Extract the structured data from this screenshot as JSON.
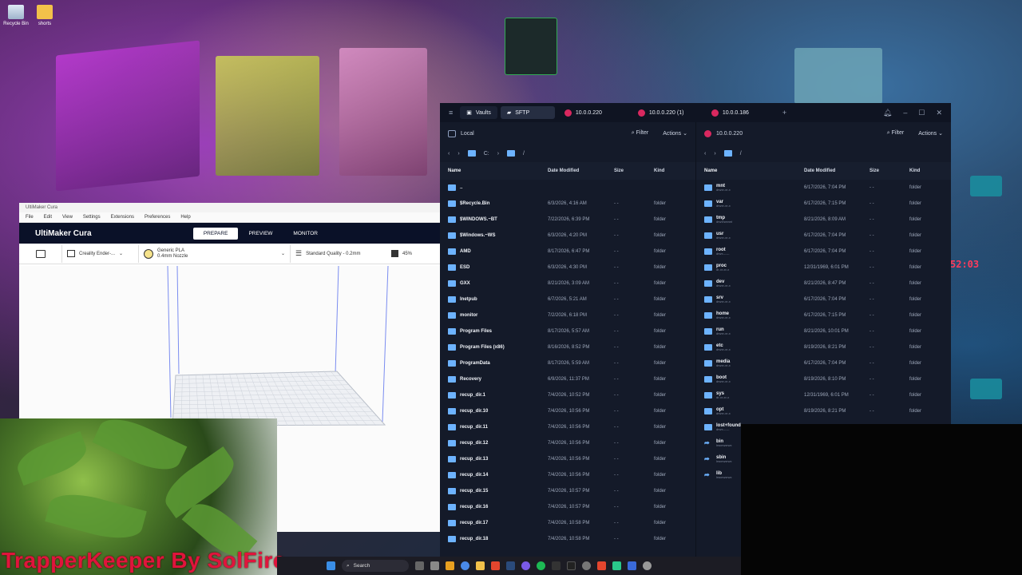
{
  "desktop": {
    "icons": [
      {
        "label": "Recycle Bin"
      },
      {
        "label": "shorts"
      }
    ],
    "clock": "52:03"
  },
  "cura": {
    "window_title": "UltiMaker Cura",
    "menu": [
      "File",
      "Edit",
      "View",
      "Settings",
      "Extensions",
      "Preferences",
      "Help"
    ],
    "logo": "UltiMaker Cura",
    "tabs": [
      "PREPARE",
      "PREVIEW",
      "MONITOR"
    ],
    "printer": "Creality Ender-...",
    "material": "Generic PLA",
    "nozzle": "0.4mm Nozzle",
    "quality": "Standard Quality - 0.2mm",
    "infill": "45%"
  },
  "termius": {
    "tabs": {
      "vaults": "Vaults",
      "sftp": "SFTP",
      "hosts": [
        "10.0.0.220",
        "10.0.0.220 (1)",
        "10.0.0.186"
      ]
    },
    "left": {
      "title": "Local",
      "filter": "Filter",
      "actions": "Actions",
      "path_drive": "C:",
      "path_sep": "/",
      "columns": [
        "Name",
        "Date Modified",
        "Size",
        "Kind"
      ],
      "rows": [
        {
          "name": "..",
          "date": "",
          "size": "",
          "kind": ""
        },
        {
          "name": "$Recycle.Bin",
          "date": "6/3/2026, 4:16 AM",
          "size": "- -",
          "kind": "folder"
        },
        {
          "name": "$WINDOWS.~BT",
          "date": "7/22/2026, 6:39 PM",
          "size": "- -",
          "kind": "folder"
        },
        {
          "name": "$Windows.~WS",
          "date": "6/3/2026, 4:20 PM",
          "size": "- -",
          "kind": "folder"
        },
        {
          "name": "AMD",
          "date": "8/17/2026, 6:47 PM",
          "size": "- -",
          "kind": "folder"
        },
        {
          "name": "ESD",
          "date": "6/3/2026, 4:30 PM",
          "size": "- -",
          "kind": "folder"
        },
        {
          "name": "GXX",
          "date": "8/21/2026, 3:09 AM",
          "size": "- -",
          "kind": "folder"
        },
        {
          "name": "Inetpub",
          "date": "6/7/2026, 5:21 AM",
          "size": "- -",
          "kind": "folder"
        },
        {
          "name": "monitor",
          "date": "7/2/2026, 6:18 PM",
          "size": "- -",
          "kind": "folder"
        },
        {
          "name": "Program Files",
          "date": "8/17/2026, 5:57 AM",
          "size": "- -",
          "kind": "folder"
        },
        {
          "name": "Program Files (x86)",
          "date": "8/16/2026, 8:52 PM",
          "size": "- -",
          "kind": "folder"
        },
        {
          "name": "ProgramData",
          "date": "8/17/2026, 5:59 AM",
          "size": "- -",
          "kind": "folder"
        },
        {
          "name": "Recovery",
          "date": "6/9/2026, 11:37 PM",
          "size": "- -",
          "kind": "folder"
        },
        {
          "name": "recup_dir.1",
          "date": "7/4/2026, 10:52 PM",
          "size": "- -",
          "kind": "folder"
        },
        {
          "name": "recup_dir.10",
          "date": "7/4/2026, 10:56 PM",
          "size": "- -",
          "kind": "folder"
        },
        {
          "name": "recup_dir.11",
          "date": "7/4/2026, 10:56 PM",
          "size": "- -",
          "kind": "folder"
        },
        {
          "name": "recup_dir.12",
          "date": "7/4/2026, 10:56 PM",
          "size": "- -",
          "kind": "folder"
        },
        {
          "name": "recup_dir.13",
          "date": "7/4/2026, 10:56 PM",
          "size": "- -",
          "kind": "folder"
        },
        {
          "name": "recup_dir.14",
          "date": "7/4/2026, 10:56 PM",
          "size": "- -",
          "kind": "folder"
        },
        {
          "name": "recup_dir.15",
          "date": "7/4/2026, 10:57 PM",
          "size": "- -",
          "kind": "folder"
        },
        {
          "name": "recup_dir.16",
          "date": "7/4/2026, 10:57 PM",
          "size": "- -",
          "kind": "folder"
        },
        {
          "name": "recup_dir.17",
          "date": "7/4/2026, 10:58 PM",
          "size": "- -",
          "kind": "folder"
        },
        {
          "name": "recup_dir.18",
          "date": "7/4/2026, 10:58 PM",
          "size": "- -",
          "kind": "folder"
        }
      ]
    },
    "right": {
      "host": "10.0.0.220",
      "filter": "Filter",
      "actions": "Actions",
      "path_sep": "/",
      "columns": [
        "Name",
        "Date Modified",
        "Size",
        "Kind"
      ],
      "rows": [
        {
          "name": "mnt",
          "perm": "drwxr-xr-x",
          "date": "6/17/2026, 7:04 PM",
          "size": "- -",
          "kind": "folder",
          "link": false
        },
        {
          "name": "var",
          "perm": "drwxr-xr-x",
          "date": "6/17/2026, 7:15 PM",
          "size": "- -",
          "kind": "folder",
          "link": false
        },
        {
          "name": "tmp",
          "perm": "drwxrwxrwt",
          "date": "8/21/2026, 8:09 AM",
          "size": "- -",
          "kind": "folder",
          "link": false
        },
        {
          "name": "usr",
          "perm": "drwxr-xr-x",
          "date": "6/17/2026, 7:04 PM",
          "size": "- -",
          "kind": "folder",
          "link": false
        },
        {
          "name": "root",
          "perm": "drwx------",
          "date": "6/17/2026, 7:04 PM",
          "size": "- -",
          "kind": "folder",
          "link": false
        },
        {
          "name": "proc",
          "perm": "dr-xr-xr-x",
          "date": "12/31/1969, 6:01 PM",
          "size": "- -",
          "kind": "folder",
          "link": false
        },
        {
          "name": "dev",
          "perm": "drwxr-xr-x",
          "date": "8/21/2026, 8:47 PM",
          "size": "- -",
          "kind": "folder",
          "link": false
        },
        {
          "name": "srv",
          "perm": "drwxr-xr-x",
          "date": "6/17/2026, 7:04 PM",
          "size": "- -",
          "kind": "folder",
          "link": false
        },
        {
          "name": "home",
          "perm": "drwxr-xr-x",
          "date": "6/17/2026, 7:15 PM",
          "size": "- -",
          "kind": "folder",
          "link": false
        },
        {
          "name": "run",
          "perm": "drwxr-xr-x",
          "date": "8/21/2026, 10:01 PM",
          "size": "- -",
          "kind": "folder",
          "link": false
        },
        {
          "name": "etc",
          "perm": "drwxr-xr-x",
          "date": "8/19/2026, 8:21 PM",
          "size": "- -",
          "kind": "folder",
          "link": false
        },
        {
          "name": "media",
          "perm": "drwxr-xr-x",
          "date": "6/17/2026, 7:04 PM",
          "size": "- -",
          "kind": "folder",
          "link": false
        },
        {
          "name": "boot",
          "perm": "drwxr-xr-x",
          "date": "8/19/2026, 8:10 PM",
          "size": "- -",
          "kind": "folder",
          "link": false
        },
        {
          "name": "sys",
          "perm": "dr-xr-xr-x",
          "date": "12/31/1969, 6:01 PM",
          "size": "- -",
          "kind": "folder",
          "link": false
        },
        {
          "name": "opt",
          "perm": "drwxr-xr-x",
          "date": "8/19/2026, 8:21 PM",
          "size": "- -",
          "kind": "folder",
          "link": false
        },
        {
          "name": "lost+found",
          "perm": "drwx------",
          "date": "",
          "size": "",
          "kind": "",
          "link": false
        },
        {
          "name": "bin",
          "perm": "lrwxrwxrwx",
          "date": "",
          "size": "",
          "kind": "",
          "link": true
        },
        {
          "name": "sbin",
          "perm": "lrwxrwxrwx",
          "date": "",
          "size": "",
          "kind": "",
          "link": true
        },
        {
          "name": "lib",
          "perm": "lrwxrwxrwx",
          "date": "",
          "size": "",
          "kind": "",
          "link": true
        }
      ]
    }
  },
  "overlay": {
    "watermark": "TrapperKeeper By SolFire"
  },
  "taskbar": {
    "search": "Search"
  }
}
